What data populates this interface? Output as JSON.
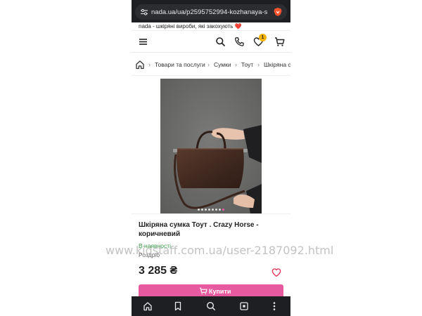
{
  "browser": {
    "url": "nada.ua/ua/p2595752994-kozhanaya-sum"
  },
  "promo": {
    "text": "nada - шкіряні вироби, які закохують ❤️"
  },
  "header": {
    "wishlist_count": "1"
  },
  "breadcrumb": {
    "items": [
      "Товари та послуги",
      "Сумки",
      "Тоут",
      "Шкіряна с"
    ]
  },
  "gallery": {
    "dot_count": 8,
    "active_dot": 7
  },
  "product": {
    "title": "Шкіряна сумка Тоут . Crazy Horse - коричневий",
    "stock": "В наявності",
    "retail": "Роздріб",
    "price": "3 285 ₴",
    "buy_label": "Купити"
  },
  "watermark": "www.kidstaff.com.ua/user-2187092.html",
  "colors": {
    "accent_pink": "#e85aa0",
    "stock_green": "#3a9b4a",
    "badge_yellow": "#f5b400"
  }
}
